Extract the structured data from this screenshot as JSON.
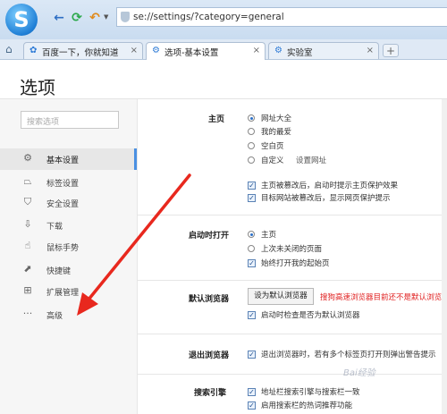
{
  "browser": {
    "url": "se://settings/?category=general",
    "tabs": [
      {
        "label": "百度一下，你就知道",
        "active": false
      },
      {
        "label": "选项-基本设置",
        "active": true
      },
      {
        "label": "实验室",
        "active": false
      }
    ],
    "new_tab": "+"
  },
  "page": {
    "title": "选项"
  },
  "sidebar": {
    "search_placeholder": "搜索选项",
    "items": [
      {
        "label": "基本设置",
        "icon": "gear-icon",
        "active": true
      },
      {
        "label": "标签设置",
        "icon": "tab-icon",
        "active": false
      },
      {
        "label": "安全设置",
        "icon": "shield-icon",
        "active": false
      },
      {
        "label": "下载",
        "icon": "download-icon",
        "active": false
      },
      {
        "label": "鼠标手势",
        "icon": "mouse-gesture-icon",
        "active": false
      },
      {
        "label": "快捷键",
        "icon": "shortcut-icon",
        "active": false
      },
      {
        "label": "扩展管理",
        "icon": "extensions-icon",
        "active": false
      },
      {
        "label": "高级",
        "icon": "more-icon",
        "active": false
      }
    ]
  },
  "settings": {
    "homepage": {
      "label": "主页",
      "options": [
        "网址大全",
        "我的最爱",
        "空白页",
        "自定义"
      ],
      "selected": 0,
      "set_url_link": "设置网址",
      "checks": [
        {
          "label": "主页被篡改后，启动时提示主页保护效果",
          "checked": true
        },
        {
          "label": "目标网站被篡改后，显示网页保护提示",
          "checked": true
        }
      ]
    },
    "startup": {
      "label": "启动时打开",
      "options": [
        "主页",
        "上次未关闭的页面"
      ],
      "selected": 0,
      "check": {
        "label": "始终打开我的起始页",
        "checked": true
      }
    },
    "default_browser": {
      "label": "默认浏览器",
      "button": "设为默认浏览器",
      "warning": "搜狗高速浏览器目前还不是默认浏览器",
      "check": {
        "label": "启动时检查是否为默认浏览器",
        "checked": true
      }
    },
    "exit": {
      "label": "退出浏览器",
      "check": {
        "label": "退出浏览器时，若有多个标签页打开则弹出警告提示",
        "checked": true
      }
    },
    "search": {
      "label": "搜索引擎",
      "checks": [
        {
          "label": "地址栏搜索引擎与搜索栏一致",
          "checked": true
        },
        {
          "label": "启用搜索栏的热词推荐功能",
          "checked": true
        }
      ]
    }
  },
  "colors": {
    "accent": "#4a90e2",
    "arrow": "#e8281e",
    "warning": "#e02020"
  },
  "watermark": "Bai经验"
}
